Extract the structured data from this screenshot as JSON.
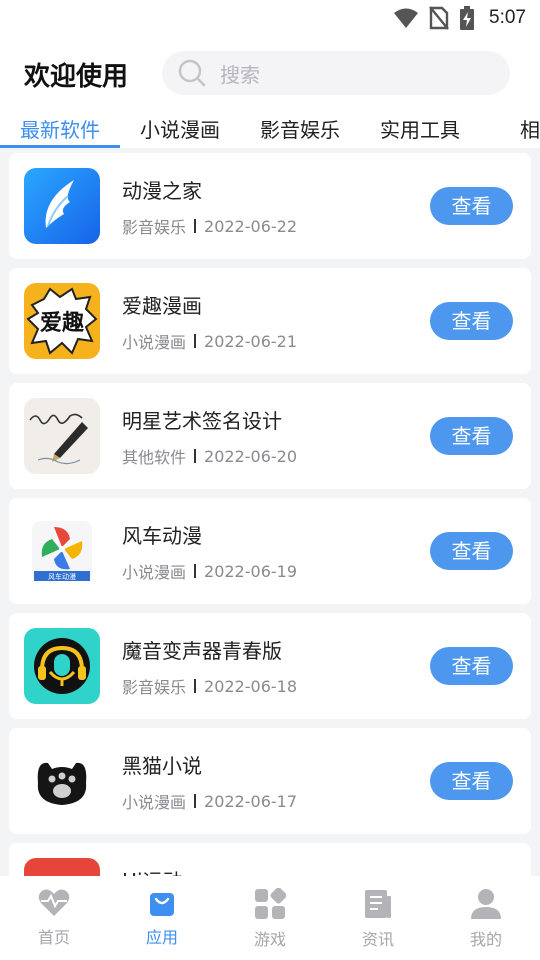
{
  "status_bar": {
    "time": "5:07"
  },
  "header": {
    "welcome": "欢迎使用",
    "search_placeholder": "搜索"
  },
  "tabs": [
    {
      "label": "最新软件",
      "active": true
    },
    {
      "label": "小说漫画",
      "active": false
    },
    {
      "label": "影音娱乐",
      "active": false
    },
    {
      "label": "实用工具",
      "active": false
    },
    {
      "label": "相机",
      "active": false
    }
  ],
  "apps": [
    {
      "name": "动漫之家",
      "category": "影音娱乐",
      "date": "2022-06-22",
      "button": "查看",
      "icon": "blue-wing-icon"
    },
    {
      "name": "爱趣漫画",
      "category": "小说漫画",
      "date": "2022-06-21",
      "button": "查看",
      "icon": "comic-burst-icon",
      "icon_text": "爱趣"
    },
    {
      "name": "明星艺术签名设计",
      "category": "其他软件",
      "date": "2022-06-20",
      "button": "查看",
      "icon": "signature-pen-icon"
    },
    {
      "name": "风车动漫",
      "category": "小说漫画",
      "date": "2022-06-19",
      "button": "查看",
      "icon": "pinwheel-icon",
      "icon_text": "风车动漫"
    },
    {
      "name": "魔音变声器青春版",
      "category": "影音娱乐",
      "date": "2022-06-18",
      "button": "查看",
      "icon": "microphone-headset-icon"
    },
    {
      "name": "黑猫小说",
      "category": "小说漫画",
      "date": "2022-06-17",
      "button": "查看",
      "icon": "cat-paw-icon"
    },
    {
      "name": "Hi运动",
      "category": "",
      "date": "",
      "button": "",
      "icon": "red-app-icon"
    }
  ],
  "bottom_nav": [
    {
      "label": "首页",
      "icon": "heart-icon",
      "active": false
    },
    {
      "label": "应用",
      "icon": "shopping-bag-icon",
      "active": true
    },
    {
      "label": "游戏",
      "icon": "grid-icon",
      "active": false
    },
    {
      "label": "资讯",
      "icon": "news-icon",
      "active": false
    },
    {
      "label": "我的",
      "icon": "user-icon",
      "active": false
    }
  ],
  "colors": {
    "accent": "#3d8ff0",
    "button": "#4d98ee",
    "background": "#f3f4f6"
  }
}
